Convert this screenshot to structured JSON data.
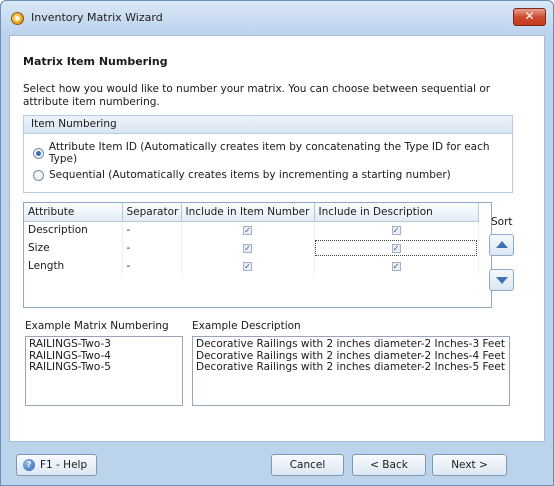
{
  "window": {
    "title": "Inventory Matrix Wizard",
    "close_glyph": "✕"
  },
  "page": {
    "heading": "Matrix Item Numbering",
    "description": "Select how you would like to number your matrix.  You can choose between sequential or attribute item numbering."
  },
  "numbering_group": {
    "title": "Item Numbering",
    "options": [
      {
        "label": "Attribute Item ID (Automatically creates item by concatenating the Type ID for each Type)",
        "selected": true
      },
      {
        "label": "Sequential (Automatically creates items by incrementing a starting number)",
        "selected": false
      }
    ]
  },
  "grid": {
    "columns": [
      "Attribute",
      "Separator",
      "Include in Item Number",
      "Include in Description"
    ],
    "rows": [
      {
        "attribute": "Description",
        "separator": "-",
        "include_number": "✓",
        "include_desc": "✓"
      },
      {
        "attribute": "Size",
        "separator": "-",
        "include_number": "✓",
        "include_desc": "✓"
      },
      {
        "attribute": "Length",
        "separator": "-",
        "include_number": "✓",
        "include_desc": "✓"
      }
    ]
  },
  "sort": {
    "label": "Sort",
    "up_icon": "triangle-up",
    "down_icon": "triangle-down"
  },
  "examples": {
    "numbering_label": "Example Matrix Numbering",
    "numbering_items": [
      "RAILINGS-Two-3",
      "RAILINGS-Two-4",
      "RAILINGS-Two-5"
    ],
    "description_label": "Example Description",
    "description_items": [
      "Decorative Railings with 2 inches diameter-2 Inches-3 Feet",
      "Decorative Railings with 2 inches diameter-2 Inches-4 Feet",
      "Decorative Railings with 2 inches diameter-2 Inches-5 Feet"
    ]
  },
  "footer": {
    "help_label": "F1 -  Help",
    "help_icon_glyph": "?",
    "cancel_label": "Cancel",
    "back_label": "< Back",
    "next_label": "Next >"
  }
}
